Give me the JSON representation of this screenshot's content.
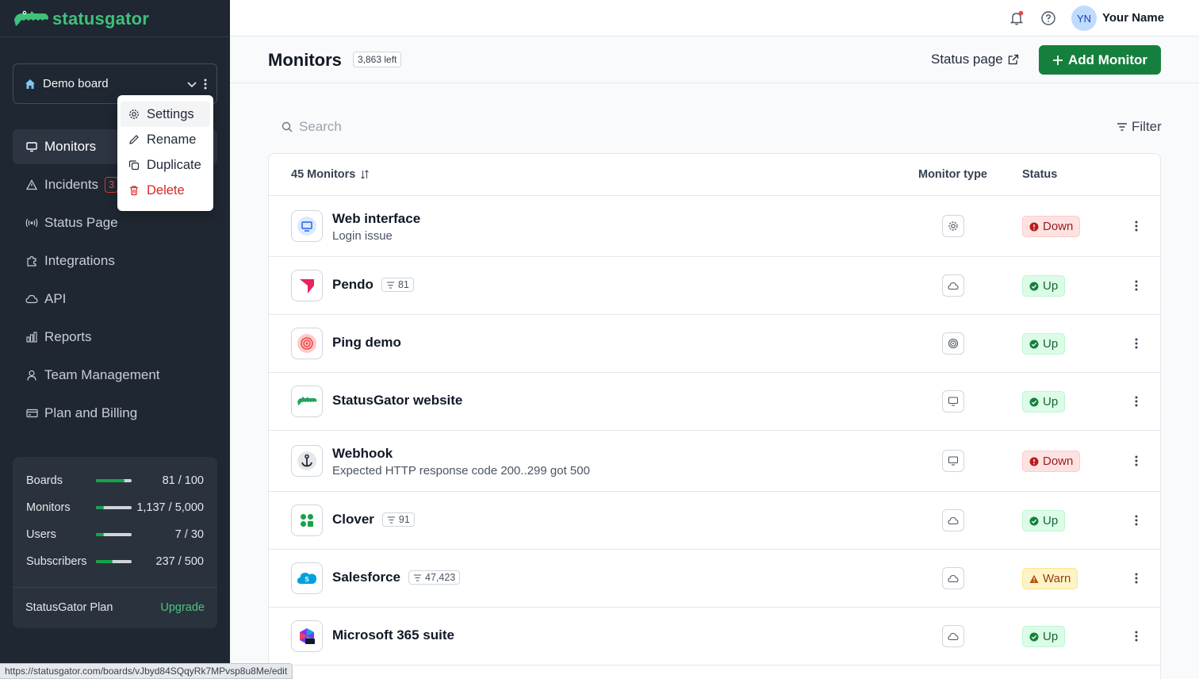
{
  "app": {
    "name": "statusgator"
  },
  "sidebar": {
    "board": {
      "name": "Demo board"
    },
    "board_menu": [
      {
        "label": "Settings",
        "icon": "gear-icon"
      },
      {
        "label": "Rename",
        "icon": "pencil-icon"
      },
      {
        "label": "Duplicate",
        "icon": "copy-icon"
      },
      {
        "label": "Delete",
        "icon": "trash-icon"
      }
    ],
    "nav": [
      {
        "label": "Monitors",
        "icon": "monitor-icon",
        "active": true
      },
      {
        "label": "Incidents",
        "icon": "warning-icon",
        "badge": "3"
      },
      {
        "label": "Status Page",
        "icon": "broadcast-icon"
      },
      {
        "label": "Integrations",
        "icon": "puzzle-icon"
      },
      {
        "label": "API",
        "icon": "cloud-icon"
      },
      {
        "label": "Reports",
        "icon": "bar-chart-icon"
      },
      {
        "label": "Team Management",
        "icon": "user-icon"
      },
      {
        "label": "Plan and Billing",
        "icon": "credit-card-icon"
      }
    ],
    "usage": [
      {
        "label": "Boards",
        "value": "81 / 100",
        "fraction": 0.81
      },
      {
        "label": "Monitors",
        "value": "1,137 / 5,000",
        "fraction": 0.23
      },
      {
        "label": "Users",
        "value": "7 / 30",
        "fraction": 0.23
      },
      {
        "label": "Subscribers",
        "value": "237 / 500",
        "fraction": 0.47
      }
    ],
    "plan": {
      "name": "StatusGator Plan",
      "upgrade_label": "Upgrade"
    }
  },
  "topbar": {
    "avatar_initials": "YN",
    "user_name": "Your Name"
  },
  "header": {
    "title": "Monitors",
    "left_count": "3,863 left",
    "status_page_label": "Status page",
    "add_button_label": "Add Monitor"
  },
  "search": {
    "placeholder": "Search"
  },
  "filter": {
    "label": "Filter"
  },
  "table": {
    "count_label": "45 Monitors",
    "col_type": "Monitor type",
    "col_status": "Status",
    "rows": [
      {
        "name": "Web interface",
        "sub": "Login issue",
        "type_icon": "gear-icon",
        "status": "Down",
        "logo": "web-monitor-logo"
      },
      {
        "name": "Pendo",
        "count": "81",
        "type_icon": "cloud-icon",
        "status": "Up",
        "logo": "pendo-logo"
      },
      {
        "name": "Ping demo",
        "type_icon": "target-icon",
        "status": "Up",
        "logo": "ping-logo"
      },
      {
        "name": "StatusGator website",
        "type_icon": "monitor-icon",
        "status": "Up",
        "logo": "statusgator-logo"
      },
      {
        "name": "Webhook",
        "sub": "Expected HTTP response code 200..299 got 500",
        "type_icon": "monitor-icon",
        "status": "Down",
        "logo": "webhook-logo"
      },
      {
        "name": "Clover",
        "count": "91",
        "type_icon": "cloud-icon",
        "status": "Up",
        "logo": "clover-logo"
      },
      {
        "name": "Salesforce",
        "count": "47,423",
        "type_icon": "cloud-icon",
        "status": "Warn",
        "logo": "salesforce-logo"
      },
      {
        "name": "Microsoft 365 suite",
        "type_icon": "cloud-icon",
        "status": "Up",
        "logo": "m365-logo"
      }
    ]
  },
  "status_url": "https://statusgator.com/boards/vJbyd84SQqyRk7MPvsp8u8Me/edit",
  "colors": {
    "brand_green": "#15803d",
    "sidebar_bg": "#1f2732",
    "logo_green": "#3fc17a"
  }
}
